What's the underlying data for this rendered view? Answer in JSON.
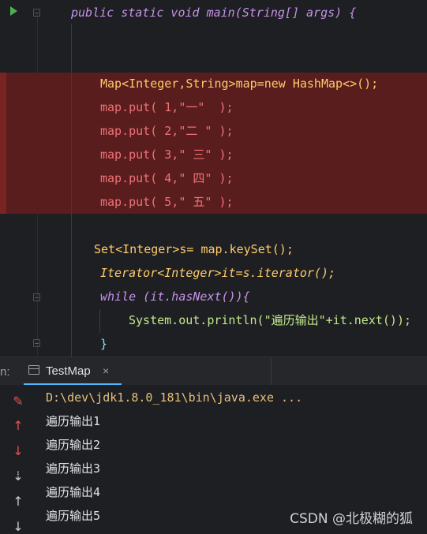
{
  "editor": {
    "lines": [
      {
        "t": "public static void main(String[] args) {"
      },
      {
        "t": "Map<Integer,String>map=new HashMap<>();"
      },
      {
        "t": "map.put( 1,\"一\"  );"
      },
      {
        "t": "map.put( 2,\"二 \" );"
      },
      {
        "t": "map.put( 3,\" 三\" );"
      },
      {
        "t": "map.put( 4,\" 四\" );"
      },
      {
        "t": "map.put( 5,\" 五\" );"
      },
      {
        "t": "Set<Integer>s= map.keySet();"
      },
      {
        "t": "Iterator<Integer>it=s.iterator();"
      },
      {
        "t": "while (it.hasNext()){"
      },
      {
        "t": "System.out.println(\"遍历输出\"+it.next());"
      },
      {
        "t": "}"
      }
    ]
  },
  "run_panel": {
    "label": "n:",
    "tab_label": "TestMap",
    "close_glyph": "×"
  },
  "console": {
    "command": "D:\\dev\\jdk1.8.0_181\\bin\\java.exe ...",
    "outputs": [
      "遍历输出1",
      "遍历输出2",
      "遍历输出3",
      "遍历输出4",
      "遍历输出5"
    ]
  },
  "watermark": "CSDN @北极糊的狐",
  "colors": {
    "highlight": "#5a1d1d",
    "tab_accent": "#4db6ff",
    "run_icon": "#4caf50",
    "tool_red": "#e05252"
  }
}
